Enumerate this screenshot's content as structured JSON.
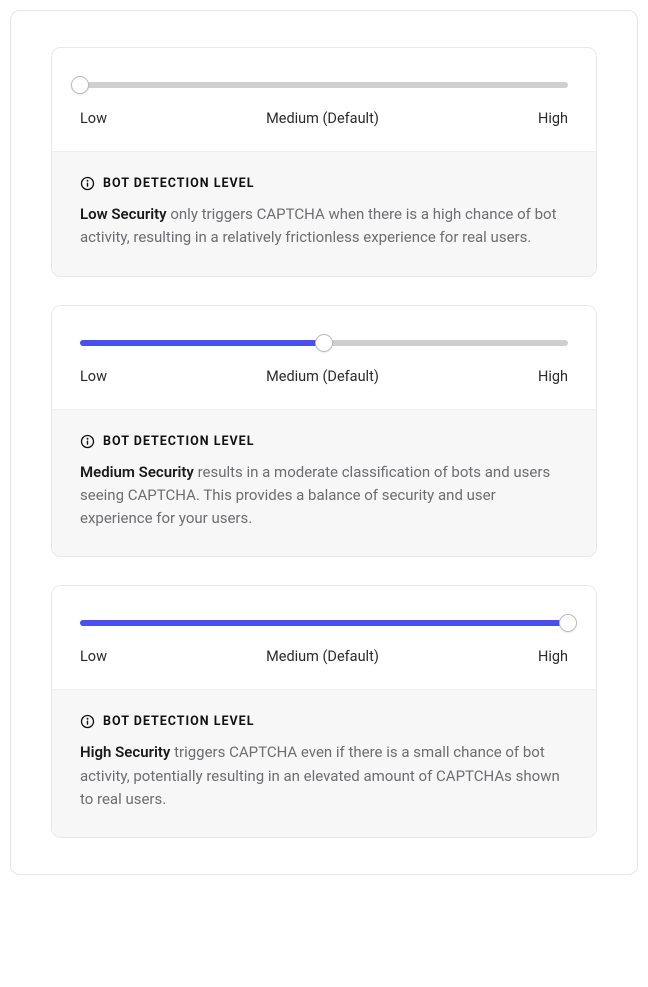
{
  "colors": {
    "accent": "#4950ed",
    "track": "#cfcfd1",
    "panel_bg": "#f7f7f7",
    "text_muted": "#6d6d72"
  },
  "slider_labels": {
    "low": "Low",
    "medium": "Medium (Default)",
    "high": "High"
  },
  "info_heading": "BOT DETECTION LEVEL",
  "info_icon": "info-icon",
  "cards": [
    {
      "level": "low",
      "thumb_percent": 0,
      "fill_percent": 0,
      "bold": "Low Security",
      "desc_rest": " only triggers CAPTCHA when there is a high chance of bot activity, resulting in a relatively frictionless experience for real users."
    },
    {
      "level": "medium",
      "thumb_percent": 50,
      "fill_percent": 50,
      "bold": "Medium Security",
      "desc_rest": " results in a moderate classification of bots and users seeing CAPTCHA. This provides a balance of security and user experience for your users."
    },
    {
      "level": "high",
      "thumb_percent": 100,
      "fill_percent": 100,
      "bold": "High Security",
      "desc_rest": " triggers CAPTCHA even if there is a small chance of bot activity, potentially resulting in an elevated amount of CAPTCHAs shown to real users."
    }
  ]
}
